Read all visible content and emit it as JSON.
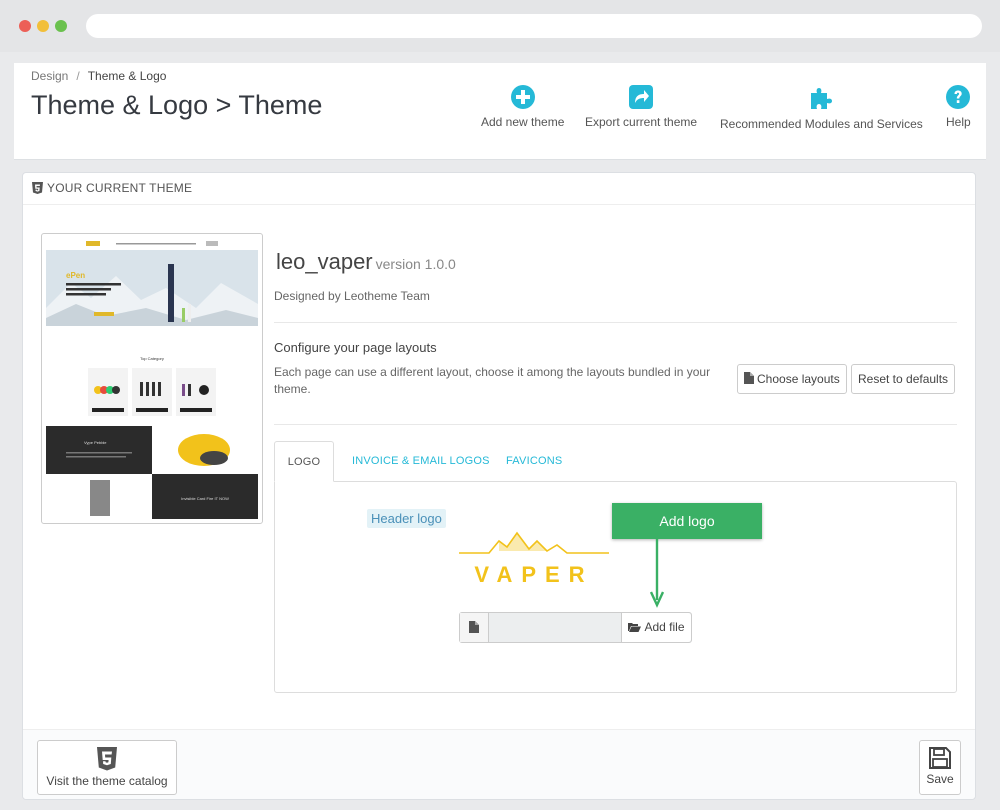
{
  "breadcrumb": {
    "parent": "Design",
    "separator": "/",
    "current": "Theme & Logo"
  },
  "page_title": "Theme & Logo > Theme",
  "toolbar": {
    "add_theme": "Add new theme",
    "export_theme": "Export current theme",
    "recommended": "Recommended Modules and Services",
    "help": "Help"
  },
  "panel": {
    "heading": "YOUR CURRENT THEME",
    "theme_name": "leo_vaper",
    "theme_version": "version 1.0.0",
    "designed_by": "Designed by Leotheme Team",
    "layouts_title": "Configure your page layouts",
    "layouts_desc": "Each page can use a different layout, choose it among the layouts bundled in your theme.",
    "choose_layouts": "Choose layouts",
    "reset_defaults": "Reset to defaults"
  },
  "tabs": [
    "LOGO",
    "INVOICE & EMAIL LOGOS",
    "FAVICONS"
  ],
  "logo_tab": {
    "header_logo_label": "Header logo",
    "logo_text": "VAPER",
    "callout": "Add logo",
    "add_file": "Add file"
  },
  "preview": {
    "hero_brand": "ePen",
    "hero_text": "Two power settings e-cig unique no-spill caps",
    "section_title": "Top Category",
    "feature_title": "Vype Pebble",
    "promo_text": "Invisible Card Fire IT NOW"
  },
  "footer": {
    "catalog": "Visit the theme catalog",
    "save": "Save"
  },
  "colors": {
    "accent": "#25b9d7",
    "callout": "#3ab065",
    "logo_gold": "#f2c21b"
  }
}
